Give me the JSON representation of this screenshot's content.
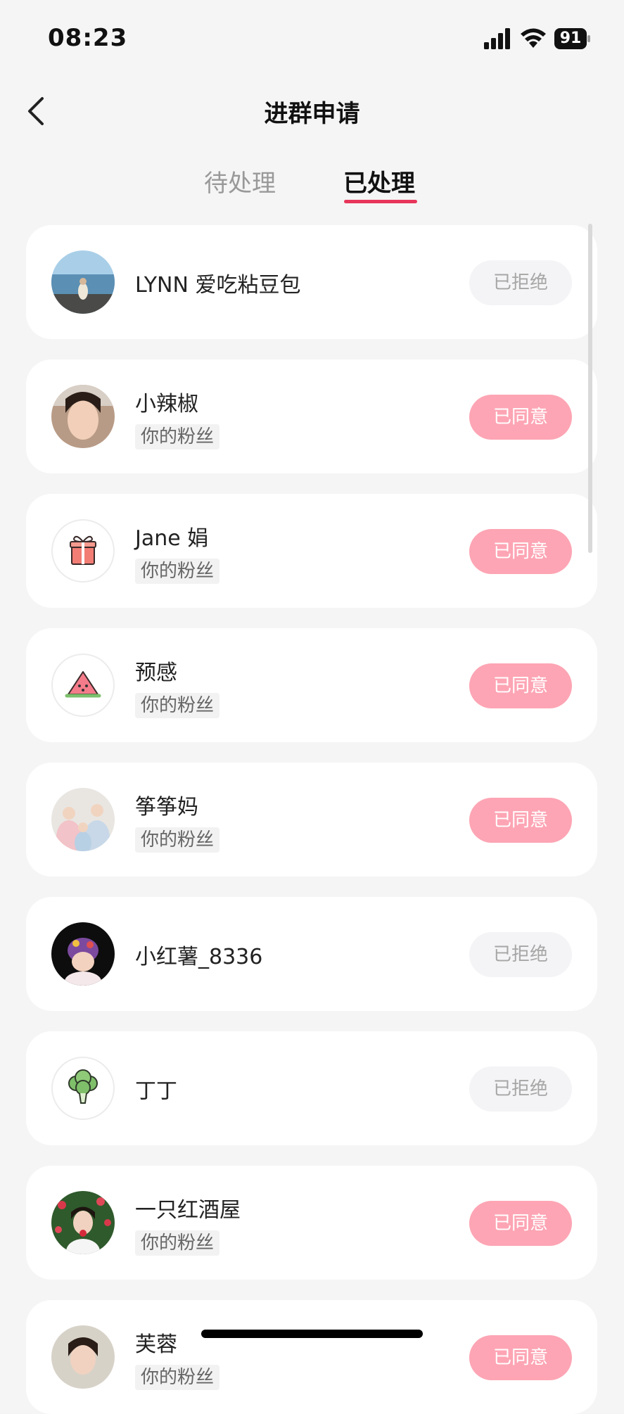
{
  "status_bar": {
    "time": "08:23",
    "battery": "91"
  },
  "header": {
    "title": "进群申请"
  },
  "tabs": [
    {
      "label": "待处理"
    },
    {
      "label": "已处理"
    }
  ],
  "colors": {
    "accent": "#e8365a",
    "agreed_bg": "#fda5b4",
    "rejected_bg": "#f4f4f6"
  },
  "requests": [
    {
      "name": "LYNN 爱吃粘豆包",
      "tag": "",
      "status": "已拒绝",
      "avatar": "photo-beach"
    },
    {
      "name": "小辣椒",
      "tag": "你的粉丝",
      "status": "已同意",
      "avatar": "photo-woman"
    },
    {
      "name": "Jane 娟",
      "tag": "你的粉丝",
      "status": "已同意",
      "avatar": "gift-icon"
    },
    {
      "name": "预感",
      "tag": "你的粉丝",
      "status": "已同意",
      "avatar": "watermelon-icon"
    },
    {
      "name": "筝筝妈",
      "tag": "你的粉丝",
      "status": "已同意",
      "avatar": "photo-family"
    },
    {
      "name": "小红薯_8336",
      "tag": "",
      "status": "已拒绝",
      "avatar": "photo-baby"
    },
    {
      "name": "丁丁",
      "tag": "",
      "status": "已拒绝",
      "avatar": "broccoli-icon"
    },
    {
      "name": "一只红酒屋",
      "tag": "你的粉丝",
      "status": "已同意",
      "avatar": "photo-flowers"
    },
    {
      "name": "芙蓉",
      "tag": "你的粉丝",
      "status": "已同意",
      "avatar": "photo-woman-2"
    }
  ]
}
